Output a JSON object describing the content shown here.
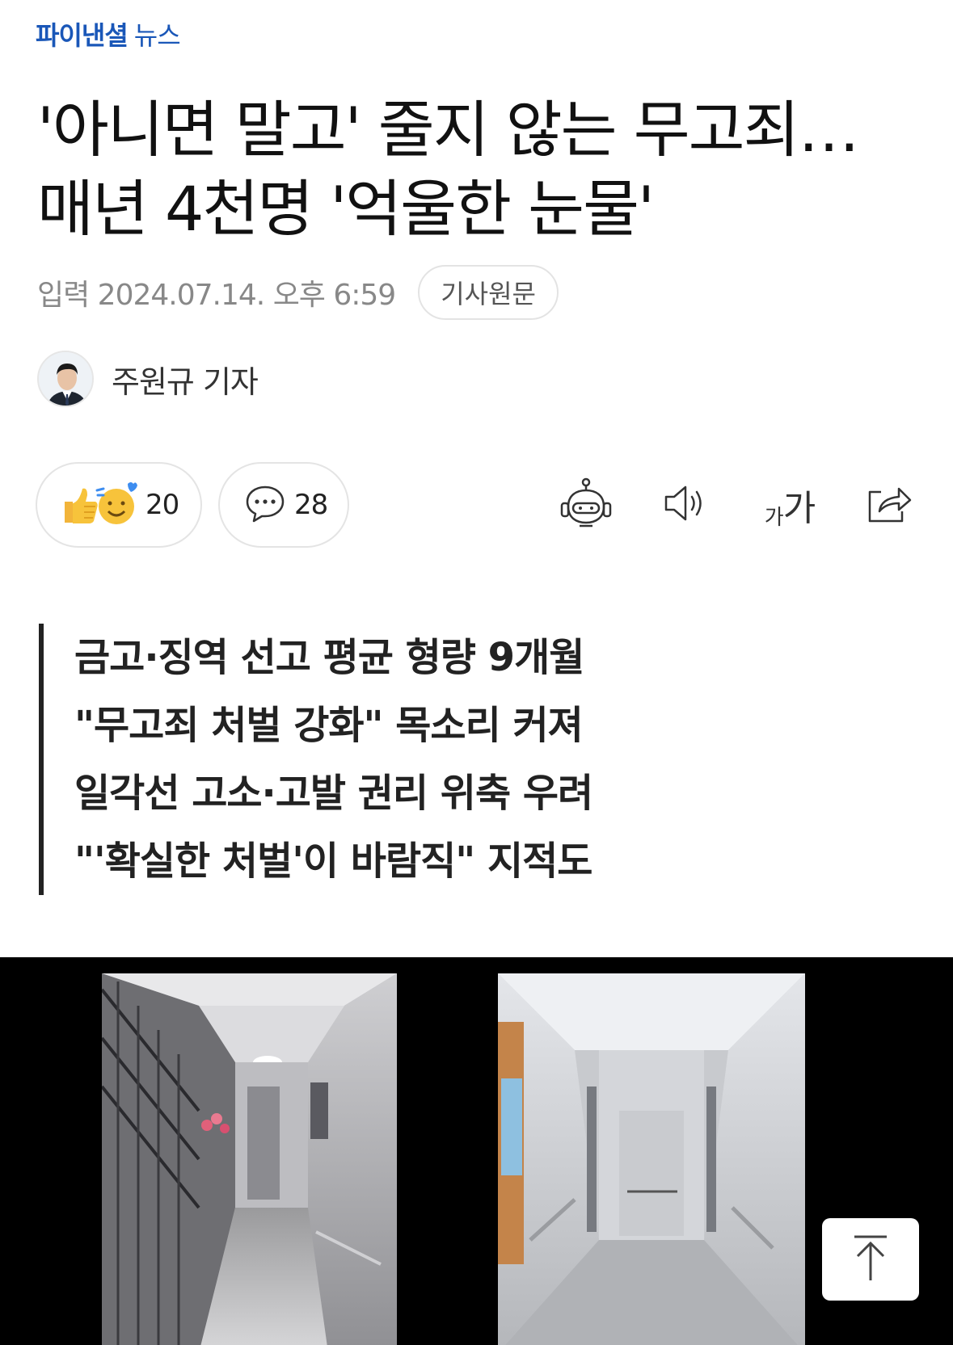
{
  "logo": {
    "main": "파이낸셜",
    "sub": "뉴스"
  },
  "article": {
    "headline_line1": "'아니면 말고' 줄지 않는 무고죄…",
    "headline_line2": "매년 4천명 '억울한 눈물'",
    "date": "입력 2024.07.14. 오후 6:59",
    "original_label": "기사원문",
    "author": "주원규 기자"
  },
  "reactions": {
    "like_count": "20",
    "comment_count": "28"
  },
  "toolbar": {
    "font_size_label_small": "가",
    "font_size_label_large": "가"
  },
  "summary": [
    "금고·징역 선고 평균 형량 9개월",
    "\"무고죄 처벌 강화\" 목소리 커져",
    "일각선 고소·고발 권리 위축 우려",
    "\"'확실한 처벌'이 바람직\" 지적도"
  ],
  "icons": {
    "reaction": "thumbs-up-smile-icon",
    "comment": "speech-bubble-icon",
    "summary_bot": "robot-icon",
    "tts": "speaker-icon",
    "font_size": "font-size-icon",
    "share": "share-icon",
    "scroll_top": "arrow-up-icon"
  },
  "colors": {
    "brand": "#1a57b8",
    "accent_yellow": "#f7c33b",
    "heart": "#3d8df0"
  }
}
